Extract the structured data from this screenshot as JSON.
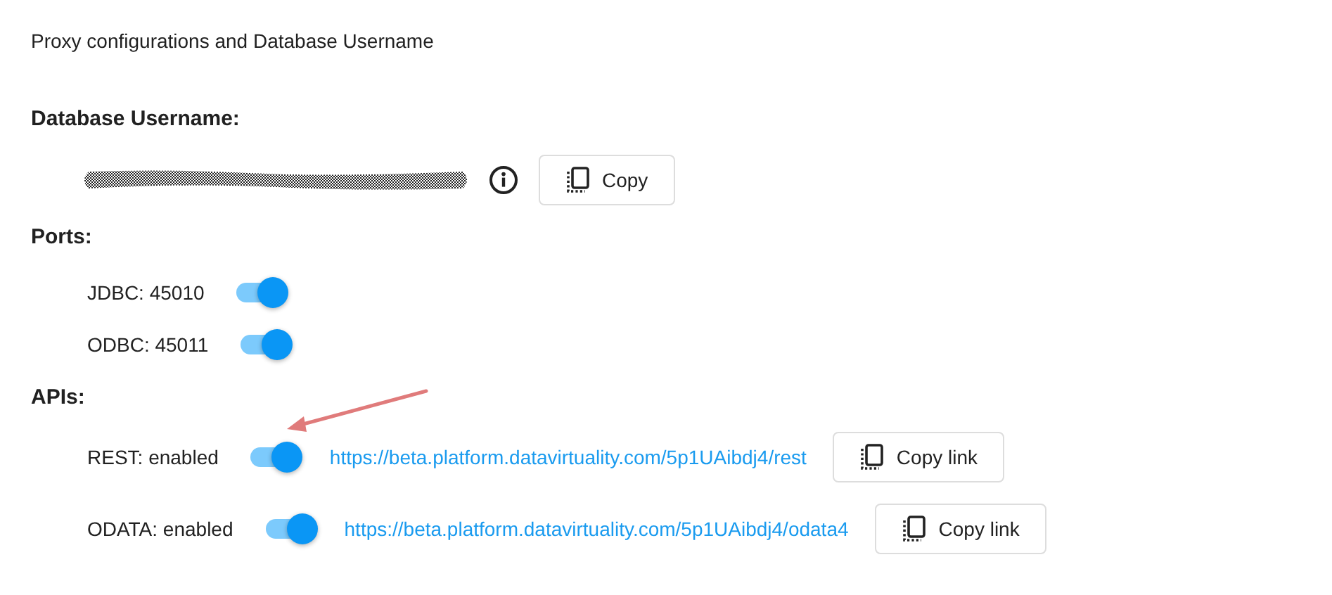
{
  "title": "Proxy configurations and Database Username",
  "database_username": {
    "heading": "Database Username:",
    "copy_button": "Copy"
  },
  "ports": {
    "heading": "Ports:",
    "items": [
      {
        "label": "JDBC: 45010",
        "on": true
      },
      {
        "label": "ODBC: 45011",
        "on": true
      }
    ]
  },
  "apis": {
    "heading": "APIs:",
    "items": [
      {
        "label": "REST: enabled",
        "on": true,
        "url": "https://beta.platform.datavirtuality.com/5p1UAibdj4/rest",
        "copy_button": "Copy link"
      },
      {
        "label": "ODATA: enabled",
        "on": true,
        "url": "https://beta.platform.datavirtuality.com/5p1UAibdj4/odata4",
        "copy_button": "Copy link"
      }
    ]
  }
}
